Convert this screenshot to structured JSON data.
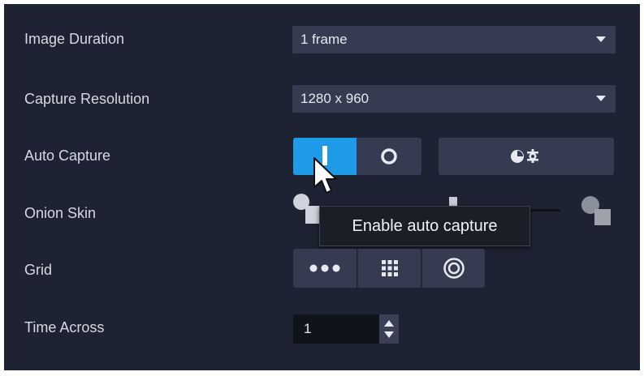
{
  "rows": {
    "image_duration": {
      "label": "Image Duration",
      "value": "1 frame"
    },
    "capture_resolution": {
      "label": "Capture Resolution",
      "value": "1280 x 960"
    },
    "auto_capture": {
      "label": "Auto Capture",
      "state": "on"
    },
    "onion_skin": {
      "label": "Onion Skin"
    },
    "grid": {
      "label": "Grid"
    },
    "time_across": {
      "label": "Time Across",
      "value": "1"
    }
  },
  "tooltip": {
    "text": "Enable auto capture"
  },
  "colors": {
    "panel": "#1d2333",
    "control": "#353c52",
    "accent": "#1e9be8",
    "text": "#d5d9e2"
  },
  "icons": {
    "auto_capture_on": "toggle-on-icon",
    "auto_capture_off": "circle-icon",
    "auto_capture_settings": "timer-settings-icon",
    "grid_dots_row": "dots-row-icon",
    "grid_dots_grid": "dots-grid-icon",
    "grid_target": "target-icon",
    "cursor": "mouse-pointer-icon"
  }
}
